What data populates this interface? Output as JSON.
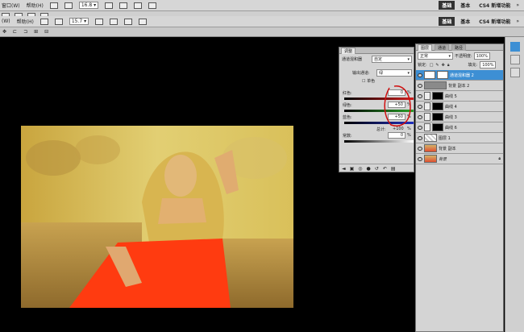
{
  "menubar": {
    "items": [
      "窗口(W)",
      "帮助(H)"
    ],
    "zoom": "16.8"
  },
  "optionsbar": {
    "items": [
      "(W)",
      "帮助(H)"
    ],
    "zoom": "15.7"
  },
  "workspaces": {
    "top": [
      "基础",
      "基本",
      "CS4 新增功能"
    ],
    "second": [
      "基础",
      "基本",
      "CS4 新增功能"
    ]
  },
  "adjustments": {
    "tab_label": "调整",
    "title": "通道混和器",
    "preset": "自定",
    "output_channel_label": "输出通道:",
    "output_channel_value": "绿",
    "monochrome_label": "单色",
    "channels": [
      {
        "label": "红色:",
        "value": "0",
        "unit": "%",
        "color": "#d22020"
      },
      {
        "label": "绿色:",
        "value": "+50",
        "unit": "%",
        "color": "#2aa02a"
      },
      {
        "label": "蓝色:",
        "value": "+50",
        "unit": "%",
        "color": "#2030c0"
      }
    ],
    "total_label": "总计:",
    "total_value": "+100",
    "total_unit": "%",
    "constant_label": "常数:",
    "constant_value": "0",
    "constant_unit": "%"
  },
  "layers": {
    "tabs": [
      "图层",
      "通道",
      "路径"
    ],
    "blend_mode": "正常",
    "opacity_label": "不透明度:",
    "opacity_value": "100%",
    "lock_label": "锁定:",
    "fill_label": "填充:",
    "fill_value": "100%",
    "items": [
      {
        "name": "通道混和器 2",
        "selected": true,
        "kind": "adjustment"
      },
      {
        "name": "背景 副本 2",
        "selected": false,
        "kind": "gray"
      },
      {
        "name": "曲线 5",
        "selected": false,
        "kind": "curve"
      },
      {
        "name": "曲线 4",
        "selected": false,
        "kind": "curve"
      },
      {
        "name": "曲线 3",
        "selected": false,
        "kind": "curve"
      },
      {
        "name": "曲线 6",
        "selected": false,
        "kind": "curve"
      },
      {
        "name": "图层 1",
        "selected": false,
        "kind": "layer"
      },
      {
        "name": "背景 副本",
        "selected": false,
        "kind": "photo"
      },
      {
        "name": "背景",
        "selected": false,
        "kind": "photo-locked"
      }
    ]
  },
  "colors": {
    "accent": "#3d8fd4",
    "annotation": "#d01010",
    "dress": "#ff3b10",
    "photo_bg": "#c9a43a"
  }
}
